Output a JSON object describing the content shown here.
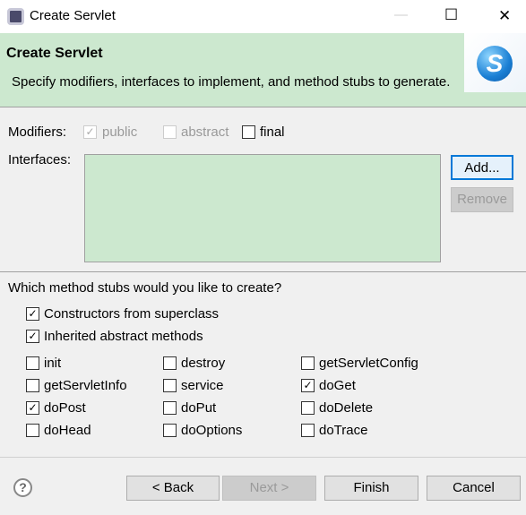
{
  "window": {
    "title": "Create Servlet",
    "minimize": "—",
    "maximize": "☐",
    "close": "✕"
  },
  "header": {
    "title": "Create Servlet",
    "description": "Specify modifiers, interfaces to implement, and method stubs to generate.",
    "logo_letter": "S"
  },
  "modifiers": {
    "label": "Modifiers:",
    "items": [
      {
        "label": "public",
        "checked": true,
        "enabled": false
      },
      {
        "label": "abstract",
        "checked": false,
        "enabled": false
      },
      {
        "label": "final",
        "checked": false,
        "enabled": true
      }
    ]
  },
  "interfaces": {
    "label": "Interfaces:",
    "add": "Add...",
    "remove": "Remove"
  },
  "stubs": {
    "question": "Which method stubs would you like to create?",
    "top": [
      {
        "label": "Constructors from superclass",
        "checked": true
      },
      {
        "label": "Inherited abstract methods",
        "checked": true
      }
    ],
    "grid": [
      {
        "label": "init",
        "checked": false
      },
      {
        "label": "destroy",
        "checked": false
      },
      {
        "label": "getServletConfig",
        "checked": false
      },
      {
        "label": "getServletInfo",
        "checked": false
      },
      {
        "label": "service",
        "checked": false
      },
      {
        "label": "doGet",
        "checked": true
      },
      {
        "label": "doPost",
        "checked": true
      },
      {
        "label": "doPut",
        "checked": false
      },
      {
        "label": "doDelete",
        "checked": false
      },
      {
        "label": "doHead",
        "checked": false
      },
      {
        "label": "doOptions",
        "checked": false
      },
      {
        "label": "doTrace",
        "checked": false
      }
    ]
  },
  "footer": {
    "help": "?",
    "back": "< Back",
    "next": "Next >",
    "finish": "Finish",
    "cancel": "Cancel"
  }
}
